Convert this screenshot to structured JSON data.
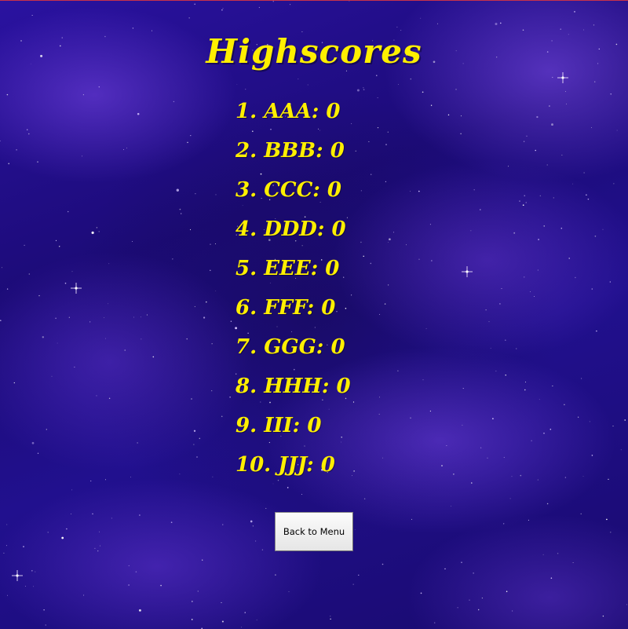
{
  "screen": {
    "title": "Highscores"
  },
  "highscores": [
    {
      "text": "1. AAA: 0"
    },
    {
      "text": "2. BBB: 0"
    },
    {
      "text": "3. CCC: 0"
    },
    {
      "text": "4. DDD: 0"
    },
    {
      "text": "5. EEE: 0"
    },
    {
      "text": "6. FFF: 0"
    },
    {
      "text": "7. GGG: 0"
    },
    {
      "text": "8. HHH: 0"
    },
    {
      "text": "9. III: 0"
    },
    {
      "text": "10. JJJ: 0"
    }
  ],
  "buttons": {
    "back_label": "Back to Menu"
  },
  "colors": {
    "text_accent": "#ffef00",
    "background": "#21108e"
  }
}
